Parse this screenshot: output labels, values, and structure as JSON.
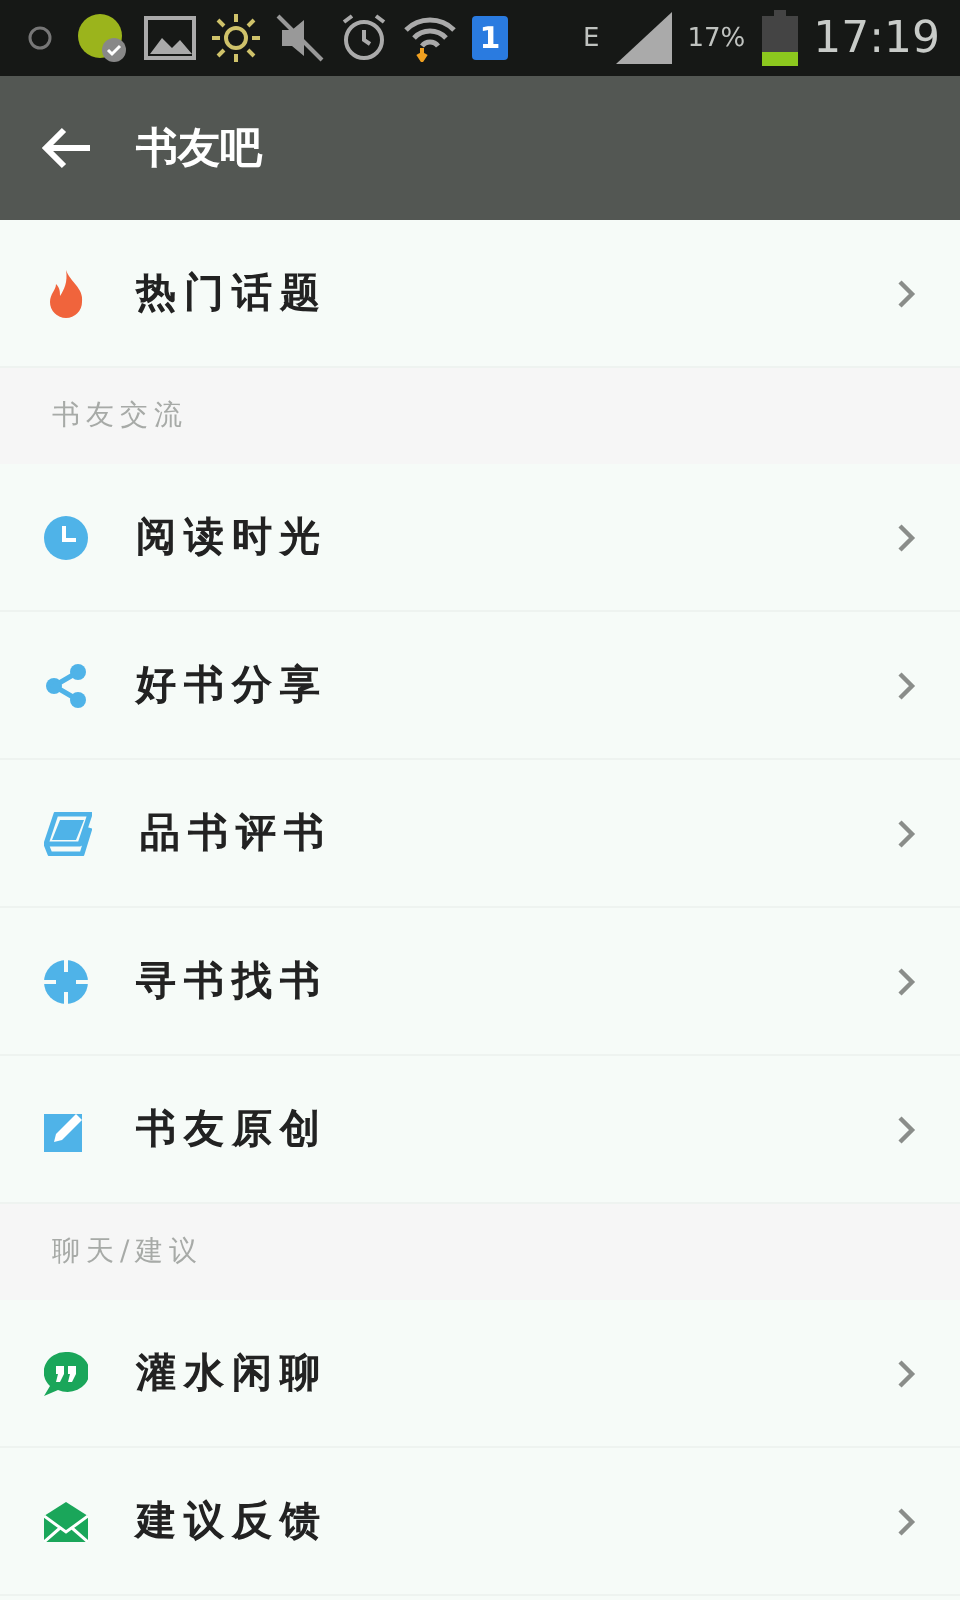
{
  "status_bar": {
    "sim": "1",
    "network": "E",
    "battery": "17%",
    "time": "17:19"
  },
  "app_bar": {
    "title": "书友吧"
  },
  "list": [
    {
      "kind": "item",
      "label": "热门话题"
    },
    {
      "kind": "header",
      "label": "书友交流"
    },
    {
      "kind": "item",
      "label": "阅读时光"
    },
    {
      "kind": "item",
      "label": "好书分享"
    },
    {
      "kind": "item",
      "label": "品书评书"
    },
    {
      "kind": "item",
      "label": "寻书找书"
    },
    {
      "kind": "item",
      "label": "书友原创"
    },
    {
      "kind": "header",
      "label": "聊天/建议"
    },
    {
      "kind": "item",
      "label": "灌水闲聊"
    },
    {
      "kind": "item",
      "label": "建议反馈"
    }
  ]
}
